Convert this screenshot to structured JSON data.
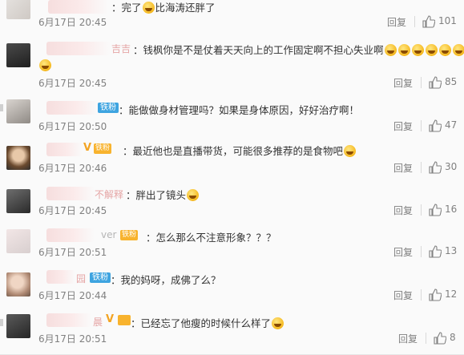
{
  "reply_label": "回复",
  "comments": [
    {
      "content": "：完了",
      "content2": "比海涛还胖了",
      "time": "6月17日 20:45",
      "likes": "101"
    },
    {
      "name_tail": "吉吉",
      "content": "：钱枫你是不是仗着天天向上的工作固定啊不担心失业啊",
      "time": "6月17日 20:45",
      "likes": "85"
    },
    {
      "fan_badge": "铁粉",
      "content": "：能做做身材管理吗？如果是身体原因，好好治疗啊！",
      "time": "6月17日 20:50",
      "likes": "47"
    },
    {
      "lvl_badge": "铁粉",
      "content": "：最近他也是直播带货，可能很多推荐的是食物吧",
      "time": "6月17日 20:46",
      "likes": "30"
    },
    {
      "name_tail": "不解释",
      "content": "：胖出了镜头",
      "time": "6月17日 20:45",
      "likes": "16"
    },
    {
      "name_tail": "ver",
      "lvl_badge": "铁粉",
      "content": "：怎么那么不注意形象？？？",
      "time": "6月17日 20:51",
      "likes": "13"
    },
    {
      "name_tail": "园",
      "fan_badge": "铁粉",
      "content": "：我的妈呀，成佛了么？",
      "time": "6月17日 20:44",
      "likes": "12"
    },
    {
      "name_tail": "晨",
      "content": "：已经忘了他瘦的时候什么样了",
      "time": "6月17日 20:51",
      "likes": "8"
    }
  ]
}
